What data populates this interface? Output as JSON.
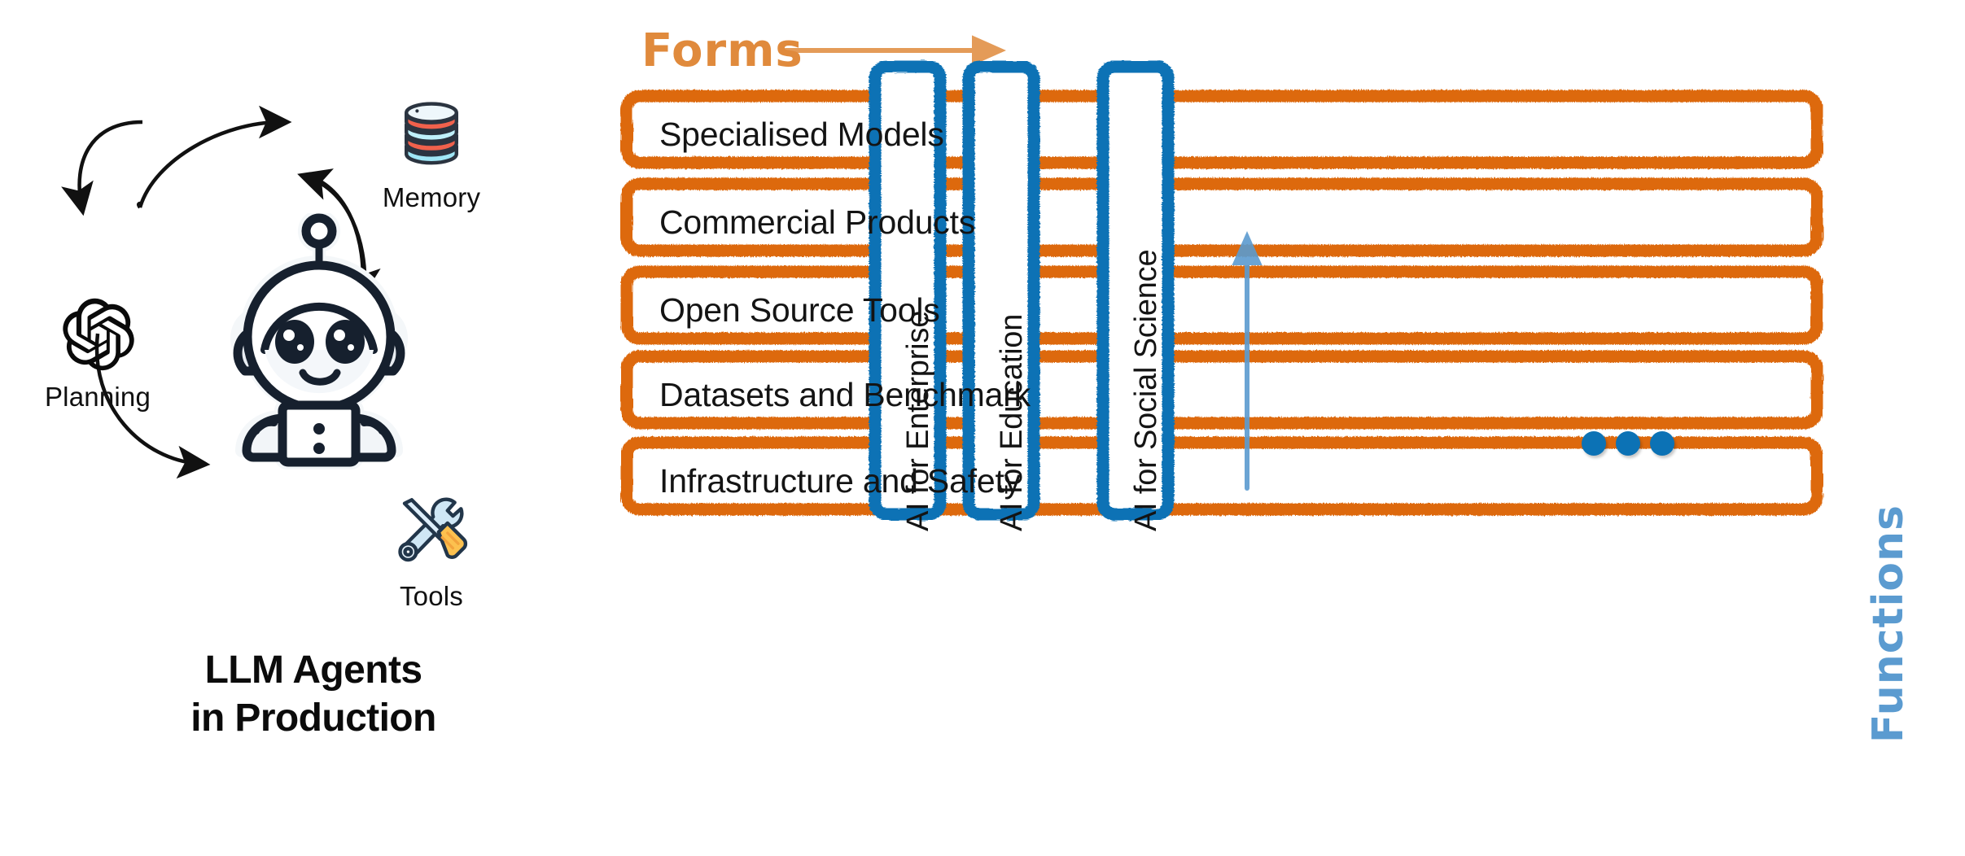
{
  "left": {
    "title_lines": [
      "LLM Agents",
      "in Production"
    ],
    "nodes": [
      {
        "id": "memory",
        "label": "Memory",
        "icon": "database-stack-icon"
      },
      {
        "id": "planning",
        "label": "Planning",
        "icon": "openai-logo-icon"
      },
      {
        "id": "tools",
        "label": "Tools",
        "icon": "wrench-screwdriver-icon"
      }
    ],
    "center_icon": "robot-mascot-icon",
    "arrows": [
      {
        "from": "planning",
        "to": "memory",
        "direction": "clockwise"
      },
      {
        "from": "memory",
        "to": "tools",
        "direction": "clockwise"
      },
      {
        "from": "tools",
        "to": "planning",
        "direction": "clockwise"
      }
    ]
  },
  "matrix": {
    "axis_x": {
      "label": "Forms",
      "color": "#E08A3C",
      "arrow": "right-arrow-icon"
    },
    "axis_y": {
      "label": "Functions",
      "color": "#5B9BD0",
      "arrow": "up-arrow-icon"
    },
    "row_color": "#DD690E",
    "column_color": "#0C72B5",
    "rows": [
      {
        "label": "Specialised Models"
      },
      {
        "label": "Commercial Products"
      },
      {
        "label": "Open Source Tools"
      },
      {
        "label": "Datasets and Benchmark"
      },
      {
        "label": "Infrastructure and Safety"
      }
    ],
    "columns": [
      {
        "label": "AI for Enterprise"
      },
      {
        "label": "AI for Education"
      },
      {
        "label": "AI for Social Science"
      }
    ],
    "more_indicator": "ellipsis-dots"
  }
}
